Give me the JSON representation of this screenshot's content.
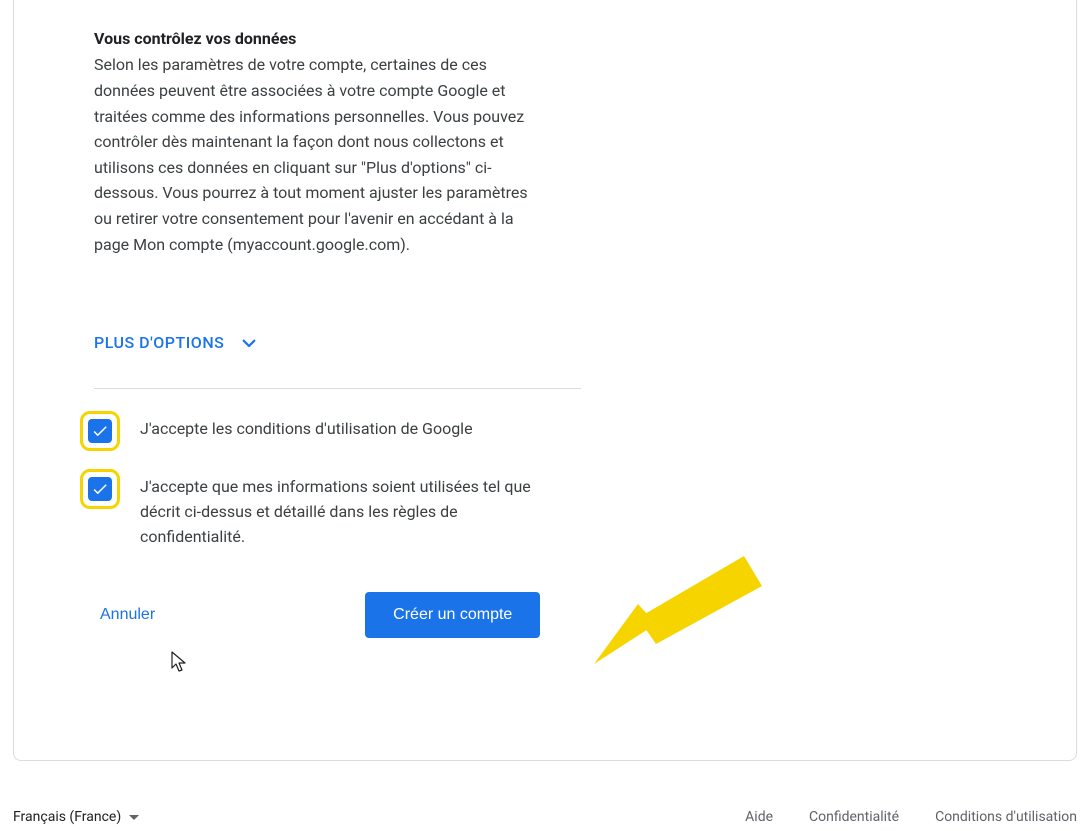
{
  "colors": {
    "primary": "#1a73e8",
    "highlight": "#f6d400",
    "text": "#3c4043",
    "heading": "#202124"
  },
  "section": {
    "title": "Vous contrôlez vos données",
    "body": "Selon les paramètres de votre compte, certaines de ces données peuvent être associées à votre compte Google et traitées comme des informations personnelles. Vous pouvez contrôler dès maintenant la façon dont nous collectons et utilisons ces données en cliquant sur \"Plus d'options\" ci-dessous. Vous pourrez à tout moment ajuster les paramètres ou retirer votre consentement pour l'avenir en accédant à la page Mon compte (myaccount.google.com)."
  },
  "moreOptions": {
    "label": "PLUS D'OPTIONS"
  },
  "checkboxes": [
    {
      "label": "J'accepte les conditions d'utilisation de Google",
      "checked": true,
      "highlighted": true
    },
    {
      "label": "J'accepte que mes informations soient utilisées tel que décrit ci-dessus et détaillé dans les règles de confidentialité.",
      "checked": true,
      "highlighted": true
    }
  ],
  "actions": {
    "cancel_label": "Annuler",
    "submit_label": "Créer un compte"
  },
  "footer": {
    "language": "Français (France)",
    "links": [
      "Aide",
      "Confidentialité",
      "Conditions d'utilisation"
    ]
  }
}
